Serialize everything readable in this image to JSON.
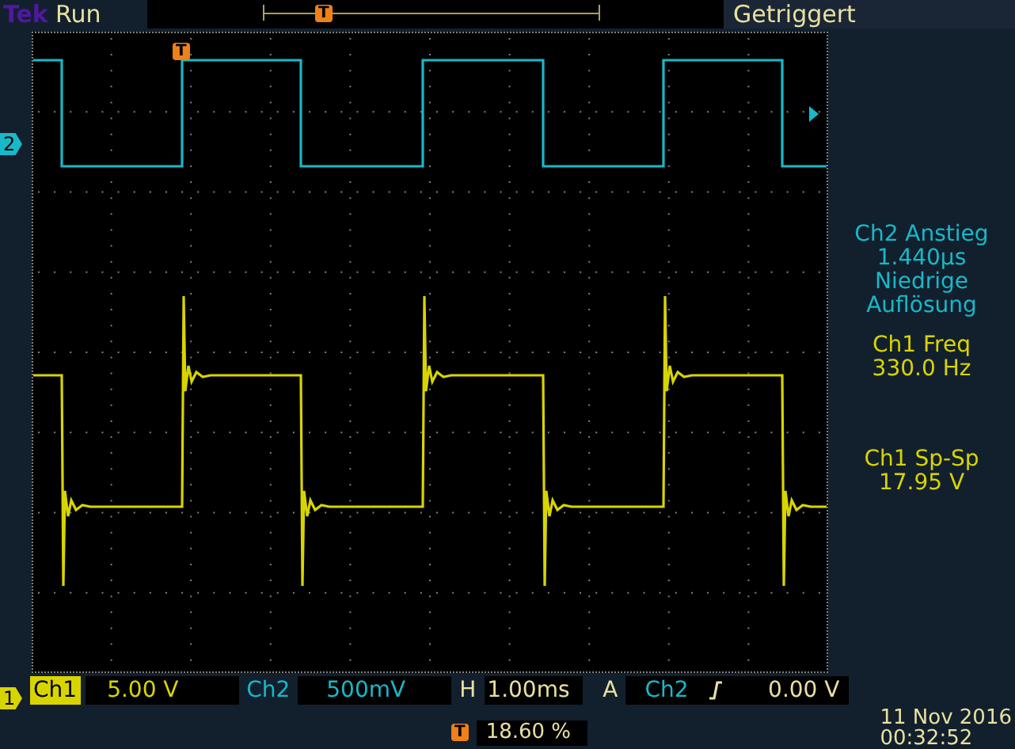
{
  "top_bar": {
    "brand": "Tek",
    "status": "Run",
    "record_trigger_marker": "T",
    "trigger_state": "Getriggert"
  },
  "plot": {
    "trigger_marker": "T",
    "channel_markers": [
      {
        "label": "2",
        "color": "#18b8c8"
      },
      {
        "label": "1",
        "color": "#d8d400"
      }
    ]
  },
  "measurements": [
    {
      "lines": [
        "Ch2 Anstieg",
        "1.440µs",
        "Niedrige",
        "Auflösung"
      ],
      "color": "#18b8c8"
    },
    {
      "lines": [
        "Ch1 Freq",
        "330.0 Hz"
      ],
      "color": "#d8d400"
    },
    {
      "lines": [
        "Ch1 Sp-Sp",
        "17.95 V"
      ],
      "color": "#d8d400"
    }
  ],
  "readout": {
    "ch1_label": "Ch1",
    "ch1_scale": "5.00 V",
    "ch2_label": "Ch2",
    "ch2_scale": "500mV",
    "horizontal_label": "H",
    "timebase": "1.00ms",
    "trigger_label": "A",
    "trigger_source": "Ch2",
    "trigger_level": "0.00 V"
  },
  "trigger_position": {
    "marker": "T",
    "value": "18.60 %"
  },
  "date": "11 Nov 2016",
  "time": "00:32:52"
}
